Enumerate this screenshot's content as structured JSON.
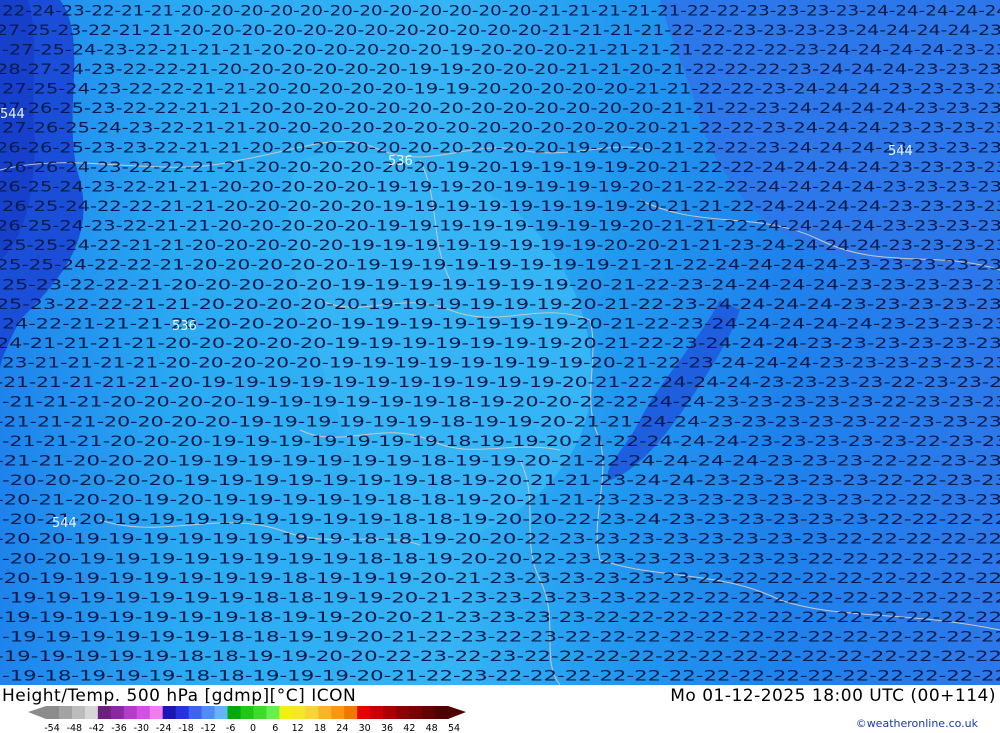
{
  "title_left": "Height/Temp. 500 hPa [gdmp][°C] ICON",
  "title_right": "Mo 01-12-2025 18:00 UTC (00+114)",
  "credit": "©weatheronline.co.uk",
  "legend": {
    "ticks": [
      "-54",
      "-48",
      "-42",
      "-36",
      "-30",
      "-24",
      "-18",
      "-12",
      "-6",
      "0",
      "6",
      "12",
      "18",
      "24",
      "30",
      "36",
      "42",
      "48",
      "54"
    ],
    "colors": [
      "#8c8c8c",
      "#a3a3a3",
      "#bcbcbc",
      "#d6d6d6",
      "#6e1e7e",
      "#8c28a0",
      "#b43cc8",
      "#d250e6",
      "#f07cf0",
      "#1e14b4",
      "#2832dc",
      "#3c64f0",
      "#508cf5",
      "#64b4fa",
      "#00aa00",
      "#1ec814",
      "#3cdc28",
      "#64f050",
      "#f0f014",
      "#f5e628",
      "#fad23c",
      "#fab428",
      "#fa9614",
      "#f07800",
      "#e60000",
      "#c80000",
      "#aa0000",
      "#8c0000",
      "#780000",
      "#640000",
      "#500000"
    ]
  },
  "map": {
    "field_colors": {
      "t18": "#3cbdf6",
      "t19": "#35b5f5",
      "t20": "#2aaaf3",
      "t21": "#2198f0",
      "t22": "#1e82ec",
      "t23": "#2c78ea",
      "t24": "#1e5fe0",
      "t25": "#1a4ed8",
      "t26": "#1640cc"
    },
    "label_color": "#0a1a4a",
    "line_color": "#c8c8c8",
    "geopotential_labels": [
      "536",
      "544",
      "536",
      "544",
      "544"
    ],
    "rows": [
      "22-24-23-22-21-21-20-20-20-20-20-20-20-20-20-20-20-20-21-21-21-21-21-22-22-23-23-23-23-24-24-24-24-24",
      "27-25-23-22-21-21-20-20-20-20-20-20-20-20-20-20-20-20-21-21-21-21-22-22-23-23-23-23-24-24-24-24-23",
      "-27-25-24-23-22-21-21-21-20-20-20-20-20-20-19-20-20-20-21-21-21-21-22-22-22-23-24-24-24-24-23-23",
      "28-27-24-23-22-22-21-20-20-20-20-20-20-19-19-20-20-20-21-21-20-21-22-22-22-23-24-24-24-23-23-23",
      "27-25-24-23-22-22-21-21-20-20-20-20-20-19-19-20-20-20-20-20-21-21-22-22-23-24-24-24-23-23-23-23",
      "27-26-25-23-22-22-21-21-20-20-20-20-20-20-20-20-20-20-20-20-20-21-21-22-23-24-24-24-24-23-23-23",
      "27-26-25-24-23-22-21-21-20-20-20-20-20-20-20-20-20-20-20-20-20-21-22-22-23-24-24-24-23-23-23-23",
      "26-26-25-23-23-22-21-21-20-20-20-20-20-20-20-20-20-20-19-20-20-21-22-22-23-24-24-24-23-23-23-23",
      "26-26-24-23-22-22-21-21-20-20-20-20-20-20-19-20-19-19-19-19-20-21-22-22-24-24-24-24-23-23-23-23",
      "26-25-24-23-22-21-21-20-20-20-20-20-19-19-19-20-19-19-19-19-20-21-22-22-24-24-24-24-23-23-23-23",
      "26-25-24-22-22-21-21-20-20-20-20-20-19-19-19-19-19-19-19-19-20-21-21-22-24-24-24-24-23-23-23-23",
      "26-25-24-23-22-21-21-20-20-20-20-20-19-19-19-19-19-19-19-19-20-21-21-22-24-24-24-24-23-23-23-23",
      "25-25-24-22-21-21-20-20-20-20-20-19-19-19-19-19-19-19-19-20-20-21-21-23-24-24-24-24-23-23-23-23",
      "25-25-24-22-22-21-20-20-20-20-20-19-19-19-19-19-19-19-19-21-21-22-24-24-24-24-23-23-23-23-23",
      "25-23-22-22-21-20-20-20-20-20-19-19-19-19-19-19-19-20-21-22-23-24-24-24-24-23-23-23-23-23",
      "25-23-22-22-21-21-20-20-20-20-20-19-19-19-19-19-19-20-21-22-23-24-24-24-24-23-23-23-23-23",
      "24-22-21-21-21-20-20-20-20-20-19-19-19-19-19-19-19-20-21-22-23-24-24-24-24-24-23-23-23-23",
      "24-21-21-21-21-20-20-20-20-20-19-19-19-19-19-19-19-20-21-22-23-24-24-24-23-23-23-23-23-23",
      "23-21-21-21-21-20-20-20-20-20-19-19-19-19-19-19-19-19-20-21-22-23-24-24-24-23-23-23-23-23-23",
      "-21-21-21-21-21-20-19-19-19-19-19-19-19-19-19-19-19-20-21-22-24-24-24-23-23-23-23-22-23-23-2",
      "-21-21-21-20-20-20-20-19-19-19-19-19-19-18-19-20-20-22-22-24-24-23-23-23-23-23-22-23-23-23",
      "-21-21-21-20-20-20-20-19-19-19-19-19-19-18-19-19-20-21-21-24-24-23-23-23-23-23-22-23-23-23",
      "-21-21-21-20-20-20-19-19-19-19-19-19-19-18-19-19-20-21-22-24-24-24-23-23-23-23-23-22-23-23",
      "-21-21-20-20-20-19-19-19-19-19-19-19-18-19-19-20-21-22-24-24-24-24-23-23-23-22-22-23-23",
      "-20-20-20-20-20-19-19-19-19-19-19-19-18-19-20-21-21-23-24-24-23-23-23-23-23-22-22-23-23",
      "-20-21-20-20-19-20-19-19-19-19-19-18-18-19-20-21-21-23-23-23-23-23-23-23-23-22-22-23-23",
      "-20-21-20-19-19-19-19-19-19-19-19-18-18-19-20-20-22-23-24-23-23-23-23-23-23-22-22-22-22",
      "-20-20-19-19-19-19-19-19-19-19-18-18-19-20-20-22-23-23-23-23-23-23-23-23-22-22-22-22-22",
      "-20-20-19-19-19-19-19-19-19-19-18-18-19-20-20-22-23-23-23-23-23-23-23-22-22-22-22-22-22",
      "-20-19-19-19-19-19-19-19-18-19-19-19-20-21-23-23-23-23-23-23-22-22-22-22-22-22-22-22-22",
      "-19-19-19-19-19-19-19-18-18-19-19-20-21-23-23-23-23-23-22-22-22-22-22-22-22-22-22-22-22",
      "-19-19-19-19-19-19-19-18-19-19-20-20-21-23-23-23-23-22-22-22-22-22-22-22-22-22-22-22-22",
      "-19-19-19-19-19-19-18-18-19-19-20-21-22-23-22-23-22-22-22-22-22-22-22-22-22-22-22-22-22",
      "-19-19-19-19-19-18-18-19-19-20-20-22-23-22-23-22-22-22-22-22-22-22-22-22-22-22-22-22-22",
      "-19-18-19-19-19-18-18-19-19-19-20-21-22-23-22-22-22-22-22-22-22-22-22-22-22-22-22-22-22"
    ]
  }
}
